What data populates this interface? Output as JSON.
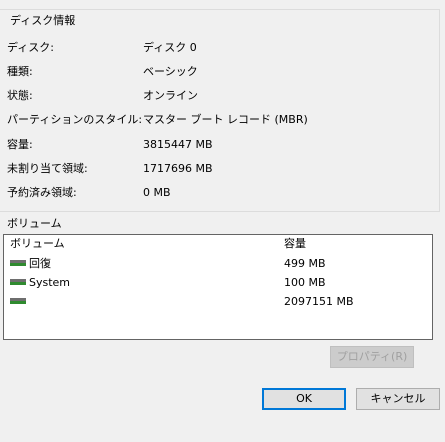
{
  "disk_info": {
    "title": "ディスク情報",
    "rows": [
      {
        "label": "ディスク:",
        "value": "ディスク 0"
      },
      {
        "label": "種類:",
        "value": "ベーシック"
      },
      {
        "label": "状態:",
        "value": "オンライン"
      },
      {
        "label": "パーティションのスタイル:",
        "value": "マスター ブート レコード (MBR)"
      },
      {
        "label": "容量:",
        "value": "3815447 MB"
      },
      {
        "label": "未割り当て領域:",
        "value": "1717696 MB"
      },
      {
        "label": "予約済み領域:",
        "value": "0 MB"
      }
    ]
  },
  "volumes": {
    "caption": "ボリューム",
    "columns": {
      "volume": "ボリューム",
      "capacity": "容量"
    },
    "rows": [
      {
        "name": "回復",
        "capacity": "499 MB",
        "icon": "drive-icon"
      },
      {
        "name": "System",
        "capacity": "100 MB",
        "icon": "drive-icon"
      },
      {
        "name": "",
        "capacity": "2097151 MB",
        "icon": "drive-icon"
      }
    ]
  },
  "buttons": {
    "properties": "プロパティ(R)",
    "ok": "OK",
    "cancel": "キャンセル"
  }
}
